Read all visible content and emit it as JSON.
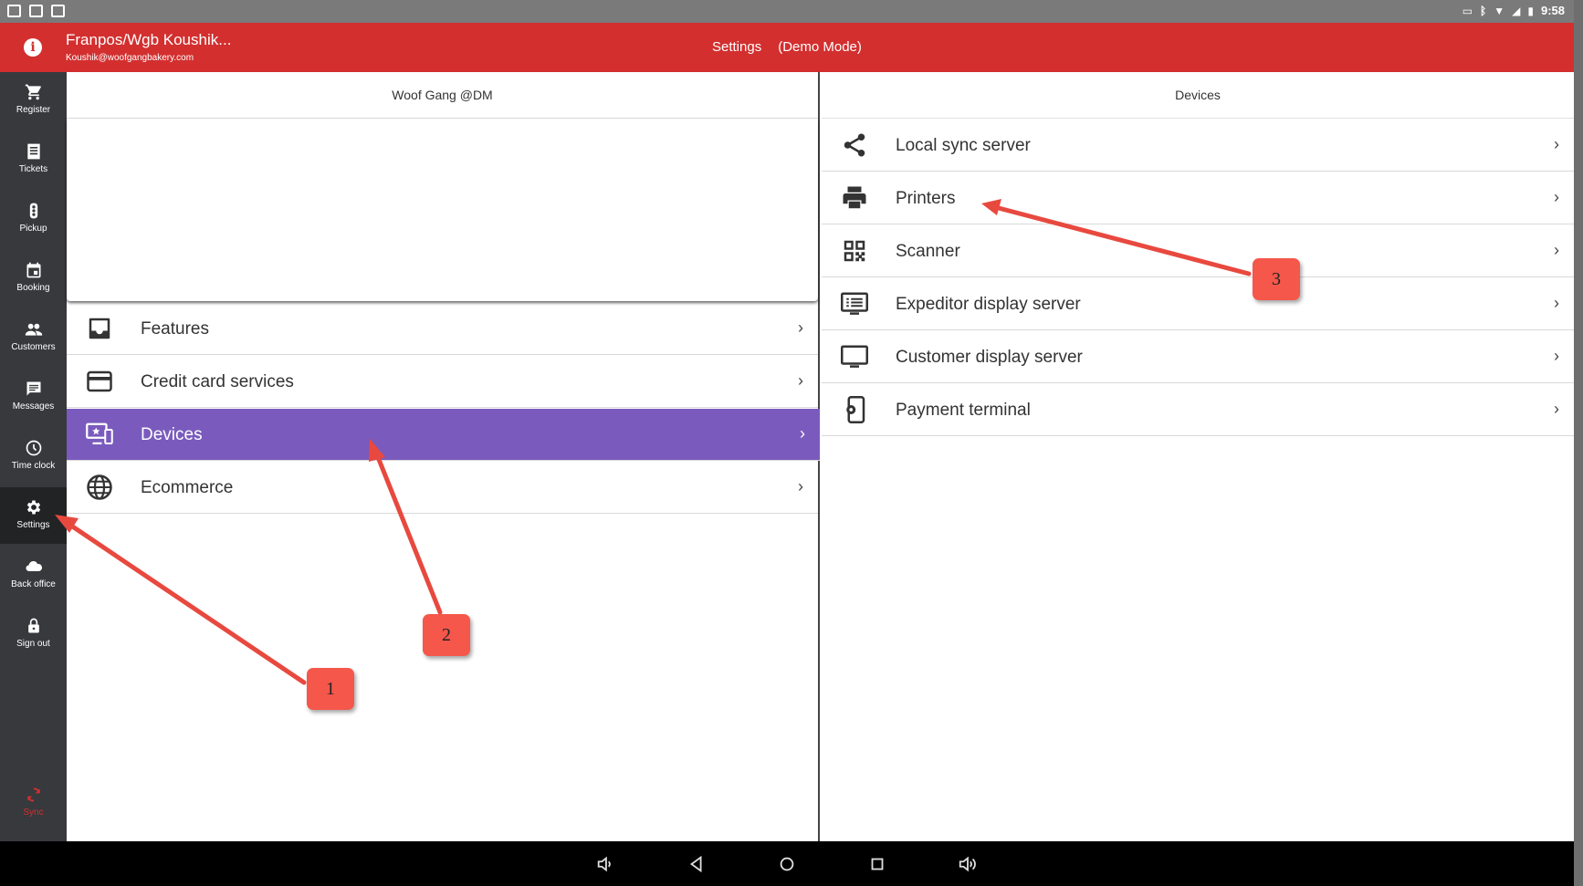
{
  "status_bar": {
    "time": "9:58"
  },
  "app_bar": {
    "user_name": "Franpos/Wgb Koushik...",
    "user_email": "Koushik@woofgangbakery.com",
    "section": "Settings",
    "mode": "(Demo Mode)"
  },
  "sidebar": {
    "items": [
      {
        "label": "Register",
        "icon": "cart-icon"
      },
      {
        "label": "Tickets",
        "icon": "receipt-icon"
      },
      {
        "label": "Pickup",
        "icon": "traffic-light-icon"
      },
      {
        "label": "Booking",
        "icon": "calendar-icon"
      },
      {
        "label": "Customers",
        "icon": "people-icon"
      },
      {
        "label": "Messages",
        "icon": "chat-icon"
      },
      {
        "label": "Time clock",
        "icon": "clock-icon"
      },
      {
        "label": "Settings",
        "icon": "gear-icon"
      },
      {
        "label": "Back office",
        "icon": "cloud-icon"
      },
      {
        "label": "Sign out",
        "icon": "lock-icon"
      }
    ],
    "active": "Settings",
    "sync_label": "Sync"
  },
  "left_pane": {
    "header": "Woof Gang @DM",
    "items": [
      {
        "label": "Features",
        "icon": "inbox-icon"
      },
      {
        "label": "Credit card services",
        "icon": "credit-card-icon"
      },
      {
        "label": "Devices",
        "icon": "devices-icon"
      },
      {
        "label": "Ecommerce",
        "icon": "globe-icon"
      }
    ],
    "selected": "Devices"
  },
  "right_pane": {
    "header": "Devices",
    "items": [
      {
        "label": "Local sync server",
        "icon": "share-icon"
      },
      {
        "label": "Printers",
        "icon": "printer-icon"
      },
      {
        "label": "Scanner",
        "icon": "qr-code-icon"
      },
      {
        "label": "Expeditor display server",
        "icon": "list-display-icon"
      },
      {
        "label": "Customer display server",
        "icon": "monitor-icon"
      },
      {
        "label": "Payment terminal",
        "icon": "payment-terminal-icon"
      }
    ]
  },
  "annotations": {
    "callouts": [
      "1",
      "2",
      "3"
    ],
    "color": "#f5574b"
  },
  "colors": {
    "app_bar": "#d32f2f",
    "sidebar": "#37393d",
    "selected_row": "#7a5bbd"
  }
}
